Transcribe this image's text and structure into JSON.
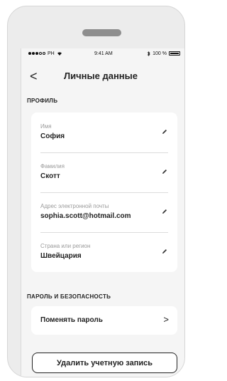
{
  "status_bar": {
    "carrier": "PH",
    "time": "9:41 AM",
    "battery": "100 %"
  },
  "header": {
    "back_glyph": "<",
    "title": "Личные данные"
  },
  "profile": {
    "section_title": "ПРОФИЛЬ",
    "fields": [
      {
        "label": "Имя",
        "value": "София"
      },
      {
        "label": "Фамилия",
        "value": "Скотт"
      },
      {
        "label": "Адрес электронной почты",
        "value": "sophia.scott@hotmail.com"
      },
      {
        "label": "Страна или регион",
        "value": "Швейцария"
      }
    ]
  },
  "security": {
    "section_title": "ПАРОЛЬ И БЕЗОПАСНОСТЬ",
    "change_password_label": "Поменять пароль",
    "chevron": ">"
  },
  "delete_account_label": "Удалить учетную запись",
  "icons": {
    "edit": "pencil-icon",
    "back": "chevron-left-icon",
    "wifi": "wifi-icon",
    "bluetooth": "bluetooth-icon",
    "battery": "battery-icon"
  }
}
